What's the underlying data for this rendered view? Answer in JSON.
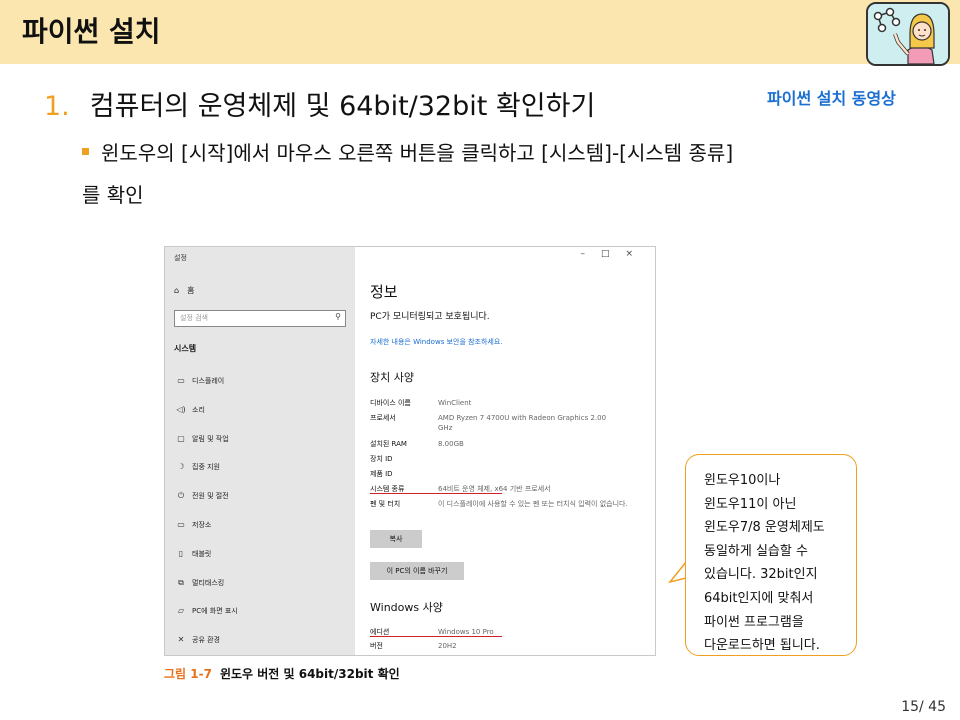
{
  "header": {
    "title": "파이썬 설치"
  },
  "heading": {
    "number": "1.",
    "text": "컴퓨터의 운영체제 및 64bit/32bit 확인하기"
  },
  "video_link": "파이썬 설치 동영상",
  "bullet": {
    "line1": "윈도우의 [시작]에서 마우스 오른쪽 버튼을 클릭하고 [시스템]-[시스템 종류]",
    "line2": "를 확인"
  },
  "screenshot": {
    "app_title": "설정",
    "home": "홈",
    "search_placeholder": "설정 검색",
    "section": "시스템",
    "nav": [
      {
        "icon": "monitor-icon",
        "label": "디스플레이"
      },
      {
        "icon": "speaker-icon",
        "label": "소리"
      },
      {
        "icon": "notification-icon",
        "label": "알림 및 작업"
      },
      {
        "icon": "moon-icon",
        "label": "집중 지원"
      },
      {
        "icon": "power-icon",
        "label": "전원 및 절전"
      },
      {
        "icon": "storage-icon",
        "label": "저장소"
      },
      {
        "icon": "tablet-icon",
        "label": "태블릿"
      },
      {
        "icon": "multitask-icon",
        "label": "멀티태스킹"
      },
      {
        "icon": "project-icon",
        "label": "PC에 화면 표시"
      },
      {
        "icon": "share-icon",
        "label": "공유 환경"
      }
    ],
    "content": {
      "title": "정보",
      "protection": "PC가 모니터링되고 보호됩니다.",
      "security_link": "자세한 내용은 Windows 보안을 참조하세요.",
      "spec_title": "장치 사양",
      "specs": [
        {
          "label": "디바이스 이름",
          "value": "WinClient"
        },
        {
          "label": "프로세서",
          "value": "AMD Ryzen 7 4700U with Radeon Graphics 2.00 GHz"
        },
        {
          "label": "설치된 RAM",
          "value": "8.00GB"
        },
        {
          "label": "장치 ID",
          "value": ""
        },
        {
          "label": "제품 ID",
          "value": ""
        },
        {
          "label": "시스템 종류",
          "value": "64비트 운영 체제, x64 기반 프로세서"
        },
        {
          "label": "펜 및 터치",
          "value": "이 디스플레이에 사용할 수 있는 펜 또는 터치식 입력이 없습니다."
        }
      ],
      "copy_button": "복사",
      "rename_button": "이 PC의 이름 바꾸기",
      "windows_title": "Windows 사양",
      "win_specs": [
        {
          "label": "에디션",
          "value": "Windows 10 Pro"
        },
        {
          "label": "버전",
          "value": "20H2"
        }
      ],
      "window_controls": [
        "–",
        "□",
        "×"
      ]
    }
  },
  "caption": {
    "figure": "그림 1-7",
    "text": "윈도우 버전 및 64bit/32bit 확인"
  },
  "callout": "윈도우10이나 윈도우11이 아닌 윈도우7/8 운영체제도 동일하게 실습할 수 있습니다. 32bit인지 64bit인지에 맞춰서 파이썬 프로그램을 다운로드하면 됩니다.",
  "page_number": "15/ 45",
  "colors": {
    "header_bg": "#fce6b0",
    "accent": "#f0a020",
    "link": "#1a6fd1",
    "underline": "#d0202a"
  }
}
